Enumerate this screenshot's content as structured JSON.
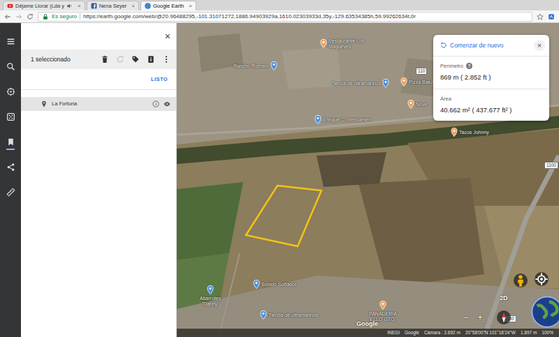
{
  "browser": {
    "tabs": [
      {
        "label": "Déjame Llorar (Lda y",
        "kind": "youtube",
        "audio": true,
        "selected": false,
        "close": "×"
      },
      {
        "label": "Nena Seyer",
        "kind": "facebook",
        "audio": false,
        "selected": false,
        "close": "×"
      },
      {
        "label": "Google Earth",
        "kind": "earth",
        "audio": false,
        "selected": true,
        "close": "×"
      }
    ],
    "secure_label": "Es seguro",
    "url": "https://earth.google.com/web/@20.96488295,-101.31071272,1886.94903929a,1610.02303933d,35y,-129.63534385h,59.99262634t,0r"
  },
  "rail": [
    {
      "kind": "menu",
      "selected": false
    },
    {
      "kind": "search",
      "selected": false
    },
    {
      "kind": "voyager",
      "selected": false
    },
    {
      "kind": "dice",
      "selected": false
    },
    {
      "kind": "bookmark",
      "selected": true
    },
    {
      "kind": "share",
      "selected": false
    },
    {
      "kind": "measure",
      "selected": false
    }
  ],
  "panel": {
    "close": "×",
    "selection": "1 seleccionado",
    "toolbar": [
      {
        "kind": "delete",
        "disabled": false
      },
      {
        "kind": "refresh",
        "disabled": true
      },
      {
        "kind": "tag",
        "disabled": false
      },
      {
        "kind": "info",
        "disabled": false
      },
      {
        "kind": "more",
        "disabled": false
      }
    ],
    "done": "LISTO",
    "items": [
      {
        "label": "La Fortuna",
        "selected": true,
        "visible": true
      }
    ]
  },
  "measure": {
    "restart": "Comenzar de nuevo",
    "close": "×",
    "perimeter_label": "Perímetro",
    "help": "?",
    "perimeter": "869 m ( 2.852 ft )",
    "area_label": "Área",
    "area": "40.662 m² ( 437.677 ft² )"
  },
  "map": {
    "labels": [
      {
        "text": "Restaurante Los Magueyes",
        "kind": "place",
        "color": "#f0a05a"
      },
      {
        "text": "Rancho Romero",
        "kind": "place",
        "color": "#4a8fe0"
      },
      {
        "text": "Tienda de ultramarinos",
        "kind": "place",
        "color": "#4a8fe0"
      },
      {
        "text": "Pizza Baez",
        "kind": "place",
        "color": "#f0a05a"
      },
      {
        "text": "Enrique C. Rebsamen",
        "kind": "place",
        "color": "#4a8fe0"
      },
      {
        "text": "Nove",
        "kind": "place",
        "color": "#f0a05a"
      },
      {
        "text": "Tacos Johnny",
        "kind": "place",
        "color": "#f0a05a"
      },
      {
        "text": "Sonido Soñador",
        "kind": "place",
        "color": "#4a8fe0"
      },
      {
        "text": "Abarrotes \"Danny\"",
        "kind": "place",
        "color": "#4a8fe0"
      },
      {
        "text": "Tienda de ultramarinos",
        "kind": "place",
        "color": "#4a8fe0"
      },
      {
        "text": "PANADERIA ELLO GTO.",
        "kind": "place",
        "color": "#f0a05a"
      },
      {
        "text": "110",
        "kind": "shield"
      },
      {
        "text": "1100",
        "kind": "shield"
      },
      {
        "text": "1100",
        "kind": "shield"
      }
    ],
    "watermark": "Google"
  },
  "controls": {
    "view_mode": "2D",
    "zoom_out": "−",
    "zoom_in": "+"
  },
  "status": [
    "INEGI",
    "Google",
    "Cámara : 2.692 m",
    "20°58'00\"N 101°18'24\"W",
    "1.897 m",
    "100%"
  ]
}
